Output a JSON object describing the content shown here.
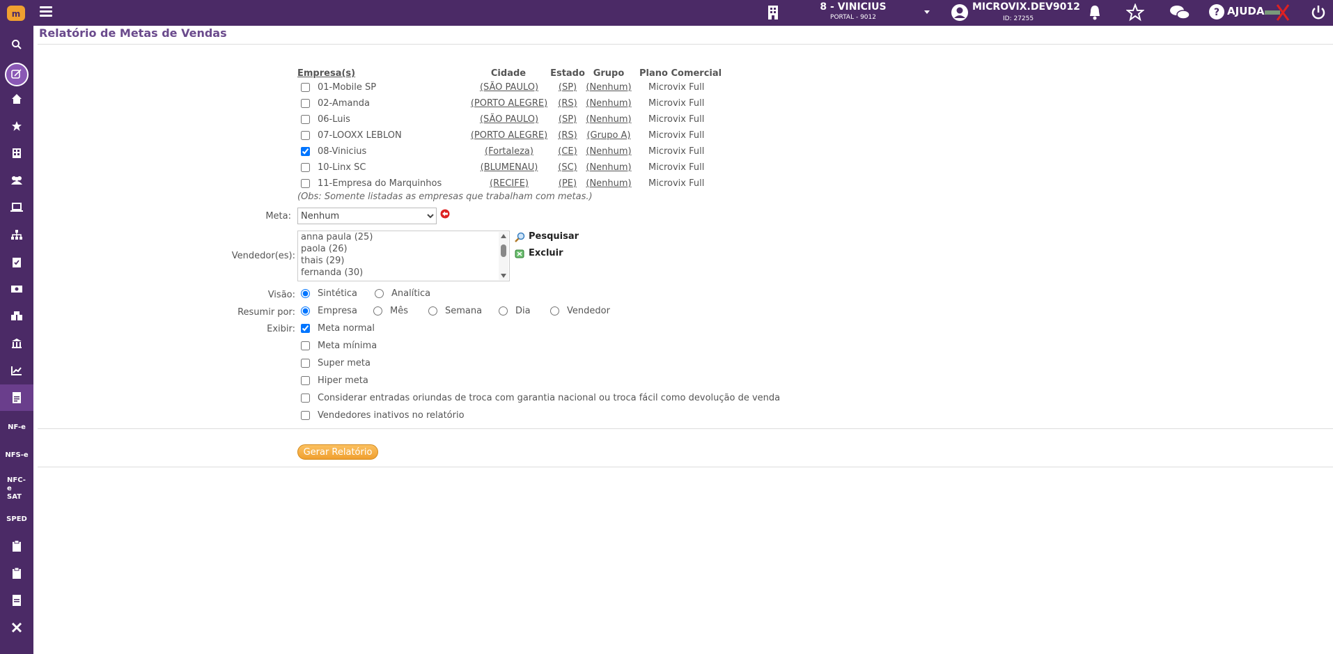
{
  "topbar": {
    "company_line1": "8 - VINICIUS",
    "company_line2": "PORTAL - 9012",
    "user_name": "MICROVIX.DEV9012",
    "user_id": "ID: 27255",
    "help_label": "AJUDA"
  },
  "sidebar": {
    "text_items": [
      "NF-e",
      "NFS-e",
      "NFC-e SAT",
      "SPED"
    ]
  },
  "page": {
    "title": "Relatório de Metas de Vendas"
  },
  "table": {
    "headers": {
      "empresa": "Empresa(s)",
      "cidade": "Cidade",
      "estado": "Estado",
      "grupo": "Grupo",
      "plano": "Plano Comercial"
    },
    "rows": [
      {
        "empresa": "01-Mobile SP",
        "cidade": "(SÃO PAULO)",
        "estado": "(SP)",
        "grupo": "(Nenhum)",
        "plano": "Microvix Full",
        "checked": false
      },
      {
        "empresa": "02-Amanda",
        "cidade": "(PORTO ALEGRE)",
        "estado": "(RS)",
        "grupo": "(Nenhum)",
        "plano": "Microvix Full",
        "checked": false
      },
      {
        "empresa": "06-Luis",
        "cidade": "(SÃO PAULO)",
        "estado": "(SP)",
        "grupo": "(Nenhum)",
        "plano": "Microvix Full",
        "checked": false
      },
      {
        "empresa": "07-LOOXX LEBLON",
        "cidade": "(PORTO ALEGRE)",
        "estado": "(RS)",
        "grupo": "(Grupo A)",
        "plano": "Microvix Full",
        "checked": false
      },
      {
        "empresa": "08-Vinicius",
        "cidade": "(Fortaleza)",
        "estado": "(CE)",
        "grupo": "(Nenhum)",
        "plano": "Microvix Full",
        "checked": true
      },
      {
        "empresa": "10-Linx SC",
        "cidade": "(BLUMENAU)",
        "estado": "(SC)",
        "grupo": "(Nenhum)",
        "plano": "Microvix Full",
        "checked": false
      },
      {
        "empresa": "11-Empresa do Marquinhos",
        "cidade": "(RECIFE)",
        "estado": "(PE)",
        "grupo": "(Nenhum)",
        "plano": "Microvix Full",
        "checked": false
      }
    ],
    "obs": "(Obs: Somente listadas as empresas que trabalham com metas.)"
  },
  "form": {
    "meta_label": "Meta:",
    "meta_value": "Nenhum",
    "vendedores_label": "Vendedor(es):",
    "vendedores": [
      "anna paula (25)",
      "paola (26)",
      "thais (29)",
      "fernanda (30)"
    ],
    "pesquisar_label": "Pesquisar",
    "excluir_label": "Excluir",
    "visao_label": "Visão:",
    "visao_options": [
      "Sintética",
      "Analítica"
    ],
    "visao_selected": "Sintética",
    "resumir_label": "Resumir por:",
    "resumir_options": [
      "Empresa",
      "Mês",
      "Semana",
      "Dia",
      "Vendedor"
    ],
    "resumir_selected": "Empresa",
    "exibir_label": "Exibir:",
    "exibir_options": [
      {
        "label": "Meta normal",
        "checked": true
      },
      {
        "label": "Meta mínima",
        "checked": false
      },
      {
        "label": "Super meta",
        "checked": false
      },
      {
        "label": "Hiper meta",
        "checked": false
      },
      {
        "label": "Considerar entradas oriundas de troca com garantia nacional ou troca fácil como devolução de venda",
        "checked": false
      },
      {
        "label": "Vendedores inativos no relatório",
        "checked": false
      }
    ],
    "submit_label": "Gerar Relatório"
  },
  "colors": {
    "brand": "#4b2a66",
    "accent": "#f0a030",
    "title": "#6a4a8c"
  }
}
